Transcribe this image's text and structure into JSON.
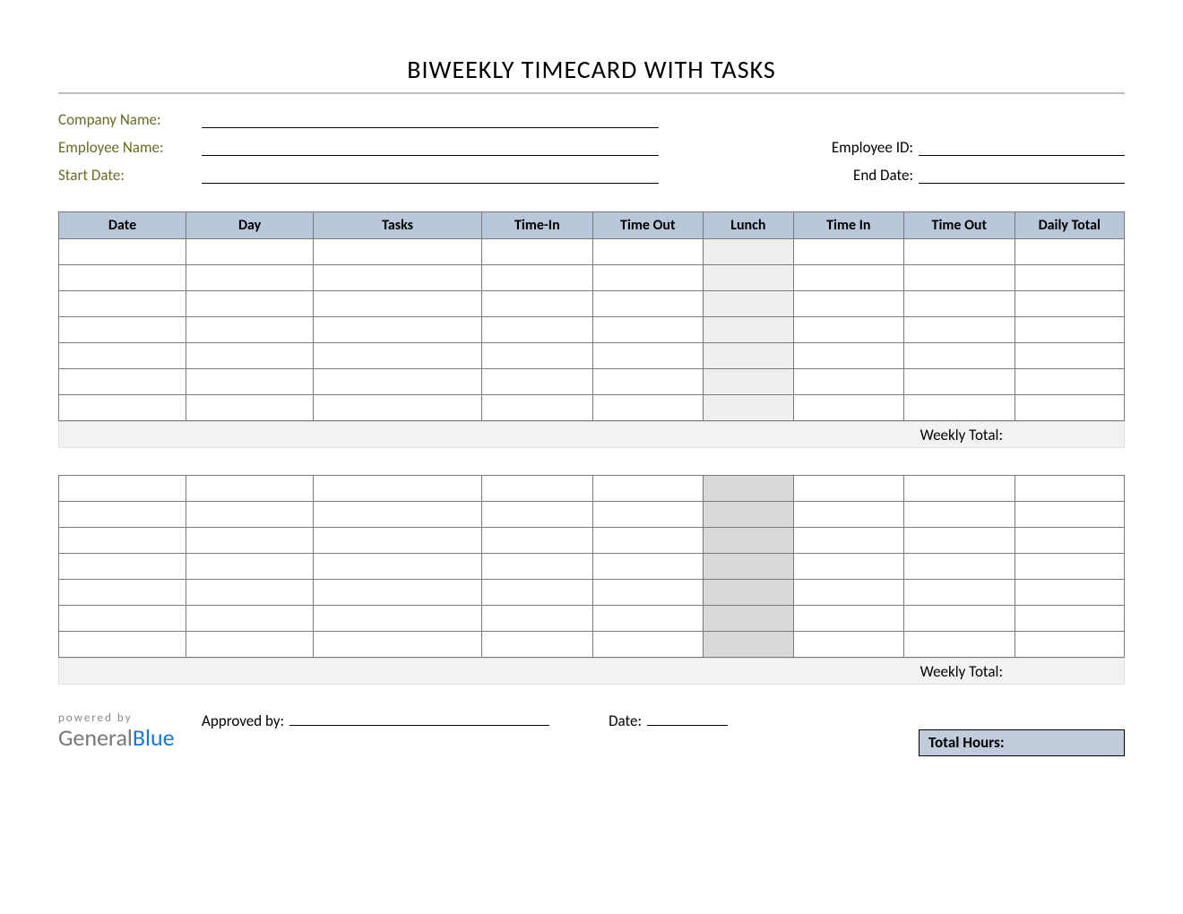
{
  "title": "BIWEEKLY TIMECARD WITH TASKS",
  "info": {
    "company_name_label": "Company Name:",
    "employee_name_label": "Employee Name:",
    "start_date_label": "Start Date:",
    "employee_id_label": "Employee ID:",
    "end_date_label": "End Date:"
  },
  "columns": {
    "date": "Date",
    "day": "Day",
    "tasks": "Tasks",
    "time_in_1": "Time-In",
    "time_out_1": "Time Out",
    "lunch": "Lunch",
    "time_in_2": "Time In",
    "time_out_2": "Time Out",
    "daily_total": "Daily Total"
  },
  "weekly_total_label": "Weekly Total:",
  "footer": {
    "powered_by": "powered by",
    "logo_general": "General",
    "logo_blue": "Blue",
    "approved_by_label": "Approved by:",
    "date_label": "Date:",
    "total_hours_label": "Total Hours:"
  }
}
